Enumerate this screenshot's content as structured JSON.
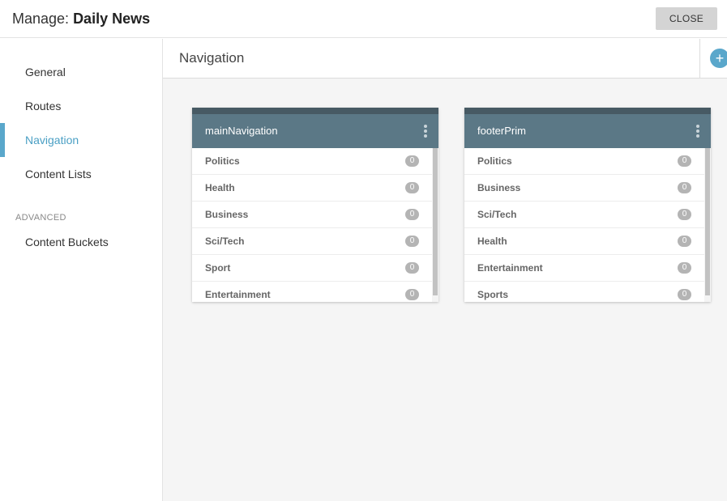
{
  "header": {
    "title_prefix": "Manage: ",
    "title_name": "Daily News",
    "close_label": "CLOSE"
  },
  "sidebar": {
    "items": [
      {
        "label": "General"
      },
      {
        "label": "Routes"
      },
      {
        "label": "Navigation",
        "active": true
      },
      {
        "label": "Content Lists"
      }
    ],
    "advanced_label": "ADVANCED",
    "advanced_items": [
      {
        "label": "Content Buckets"
      }
    ]
  },
  "main": {
    "title": "Navigation",
    "add_icon": "plus-icon"
  },
  "menus": [
    {
      "name": "mainNavigation",
      "items": [
        {
          "label": "Politics",
          "count": "0"
        },
        {
          "label": "Health",
          "count": "0"
        },
        {
          "label": "Business",
          "count": "0"
        },
        {
          "label": "Sci/Tech",
          "count": "0"
        },
        {
          "label": "Sport",
          "count": "0"
        },
        {
          "label": "Entertainment",
          "count": "0"
        }
      ]
    },
    {
      "name": "footerPrim",
      "items": [
        {
          "label": "Politics",
          "count": "0"
        },
        {
          "label": "Business",
          "count": "0"
        },
        {
          "label": "Sci/Tech",
          "count": "0"
        },
        {
          "label": "Health",
          "count": "0"
        },
        {
          "label": "Entertainment",
          "count": "0"
        },
        {
          "label": "Sports",
          "count": "0"
        }
      ]
    }
  ],
  "colors": {
    "accent": "#5aa7cb",
    "card_header": "#5b7886",
    "card_strip": "#475a64",
    "badge": "#b4b4b4",
    "close_button": "#d4d4d4",
    "content_bg": "#f5f5f5"
  }
}
